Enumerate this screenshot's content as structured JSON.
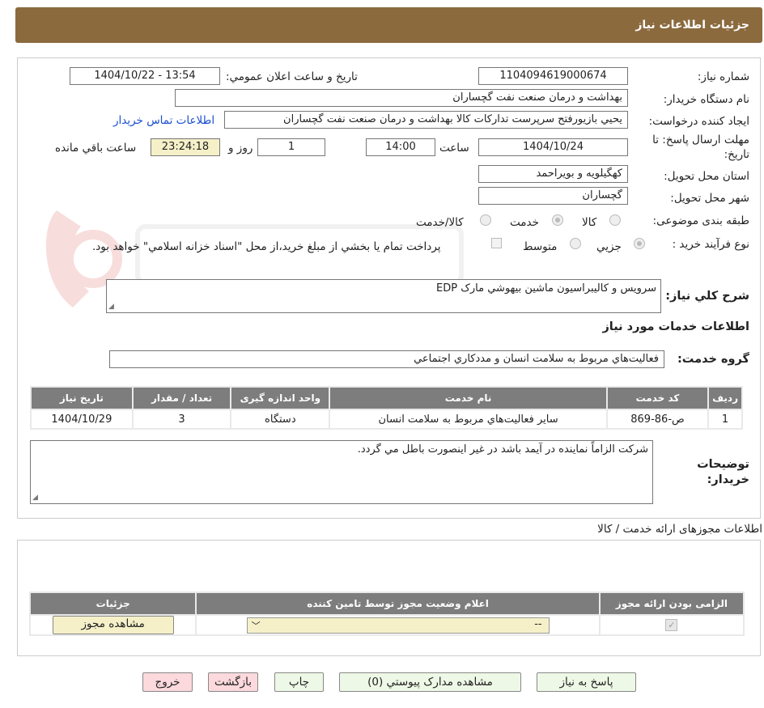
{
  "header": {
    "title": "جزئیات اطلاعات نیاز"
  },
  "fields": {
    "need_number_label": "شماره نیاز:",
    "need_number": "1104094619000674",
    "announce_label": "تاریخ و ساعت اعلان عمومي:",
    "announce_value": "1404/10/22 - 13:54",
    "buyer_org_label": "نام دستگاه خريدار:",
    "buyer_org": "بهداشت و درمان صنعت نفت گچساران",
    "creator_label": "ايجاد کننده درخواست:",
    "creator": "يحيي بازيورفتح سرپرست تدارکات کالا  بهداشت و درمان صنعت نفت گچساران",
    "contact_link": "اطلاعات تماس خريدار",
    "deadline_label_1": "مهلت ارسال پاسخ: تا",
    "deadline_label_2": "تاريخ:",
    "deadline_date": "1404/10/24",
    "time_label": "ساعت",
    "deadline_time": "14:00",
    "days_value": "1",
    "days_label": "روز و",
    "remaining_time": "23:24:18",
    "remaining_label": "ساعت باقي مانده",
    "province_label": "استان محل تحويل:",
    "province": "کهگيلويه و بويراحمد",
    "city_label": "شهر محل تحويل:",
    "city": "گچساران",
    "category_label": "طبقه بندی موضوعی:",
    "category_options": [
      "کالا",
      "خدمت",
      "کالا/خدمت"
    ],
    "category_selected": "خدمت",
    "purchase_type_label": "نوع فرآيند خريد :",
    "purchase_options": [
      "جزيي",
      "متوسط"
    ],
    "purchase_selected": "جزيي",
    "payment_note": "پرداخت تمام يا بخشي از مبلغ خريد،از محل \"اسناد خزانه اسلامي\" خواهد بود."
  },
  "description": {
    "label": "شرح کلي نياز:",
    "value": "سرويس و کاليبراسيون ماشين بيهوشي مارک EDP"
  },
  "services_section": {
    "title": "اطلاعات خدمات مورد نياز",
    "group_label": "گروه خدمت:",
    "group_value": "فعاليت‌هاي مربوط به سلامت انسان و مددکاري اجتماعي",
    "columns": [
      "رديف",
      "کد خدمت",
      "نام خدمت",
      "واحد اندازه گيری",
      "تعداد / مقدار",
      "تاريخ نياز"
    ],
    "rows": [
      [
        "1",
        "ص-86-869",
        "ساير فعاليت‌هاي مربوط به سلامت انسان",
        "دستگاه",
        "3",
        "1404/10/29"
      ]
    ]
  },
  "buyer_notes": {
    "label_1": "توضيحات",
    "label_2": "خريدار:",
    "value": "شرکت الزاماً نماينده در آيمد باشد در غير اينصورت باطل مي گردد."
  },
  "permits_section": {
    "title": "اطلاعات مجوزهای ارائه خدمت / کالا",
    "columns": [
      "الزامی بودن ارائه مجوز",
      "اعلام وضعيت مجوز توسط تامين کننده",
      "جزئيات"
    ],
    "select_value": "--",
    "view_button": "مشاهده مجوز"
  },
  "actions": {
    "reply": "پاسخ به نياز",
    "attachments": "مشاهده مدارک پيوستي (0)",
    "print": "چاپ",
    "back": "بازگشت",
    "exit": "خروج"
  },
  "colors": {
    "header_bg": "#8b6a3e",
    "table_header_bg": "#7d7d7d",
    "highlight_yellow": "#f5f0c8",
    "green_button": "#eef8e6",
    "pink_button": "#fbd9dc",
    "link": "#1a4fcf"
  }
}
